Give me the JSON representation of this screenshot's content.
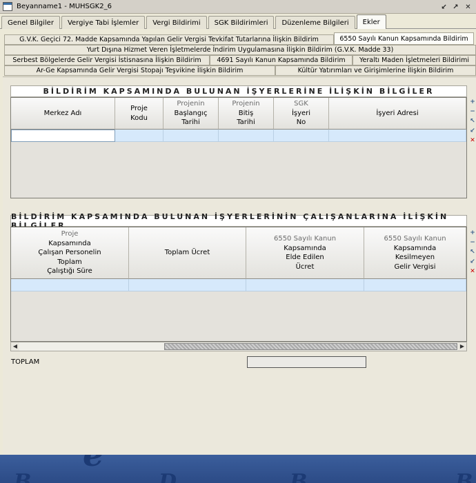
{
  "window": {
    "title": "Beyanname1 - MUHSGK2_6"
  },
  "main_tabs": [
    "Genel Bilgiler",
    "Vergiye Tabi İşlemler",
    "Vergi Bildirimi",
    "SGK Bildirimleri",
    "Düzenleme Bilgileri",
    "Ekler"
  ],
  "sub_tabs": {
    "row1": [
      "G.V.K. Geçici 72. Madde Kapsamında Yapılan Gelir Vergisi Tevkifat Tutarlarına İlişkin Bildirim",
      "6550 Sayılı Kanun Kapsamında Bildirim"
    ],
    "row2": [
      "Yurt Dışına Hizmet Veren İşletmelerde İndirim Uygulamasına İlişkin Bildirim (G.V.K. Madde 33)"
    ],
    "row3": [
      "Serbest Bölgelerde Gelir Vergisi İstisnasına İlişkin Bildirim",
      "4691 Sayılı Kanun Kapsamında Bildirim",
      "Yeraltı Maden İşletmeleri Bildirimi"
    ],
    "row4": [
      "Ar-Ge Kapsamında Gelir Vergisi Stopajı Teşvikine İlişkin Bildirim",
      "Kültür Yatırımları ve Girişimlerine İlişkin Bildirim"
    ]
  },
  "section1": {
    "title": "BİLDİRİM KAPSAMINDA BULUNAN İŞYERLERİNE İLİŞKİN BİLGİLER",
    "columns": [
      {
        "gray": "",
        "lines": [
          "Merkez Adı"
        ]
      },
      {
        "gray": "",
        "lines": [
          "Proje",
          "Kodu"
        ]
      },
      {
        "gray": "Projenin",
        "lines": [
          "Başlangıç",
          "Tarihi"
        ]
      },
      {
        "gray": "Projenin",
        "lines": [
          "Bitiş",
          "Tarihi"
        ]
      },
      {
        "gray": "SGK",
        "lines": [
          "İşyeri",
          "No"
        ]
      },
      {
        "gray": "",
        "lines": [
          "İşyeri Adresi"
        ]
      }
    ]
  },
  "section2": {
    "title": "BİLDİRİM KAPSAMINDA BULUNAN İŞYERLERİNİN ÇALIŞANLARINA İLİŞKİN BİLGİLER",
    "columns": [
      {
        "gray": "Proje",
        "lines": [
          "Kapsamında",
          "Çalışan Personelin",
          "Toplam",
          "Çalıştığı Süre"
        ]
      },
      {
        "gray": "",
        "lines": [
          "Toplam Ücret"
        ]
      },
      {
        "gray": "6550 Sayılı Kanun",
        "lines": [
          "Kapsamında",
          "Elde Edilen",
          "Ücret"
        ]
      },
      {
        "gray": "6550 Sayılı Kanun",
        "lines": [
          "Kapsamında",
          "Kesilmeyen",
          "Gelir Vergisi"
        ]
      }
    ]
  },
  "total": {
    "label": "TOPLAM",
    "value": ""
  },
  "side_buttons": [
    "add-row-icon",
    "remove-row-icon",
    "move-up-icon",
    "move-down-icon",
    "delete-icon"
  ],
  "colors": {
    "selected_row": "#d6e9fb",
    "panel_bg": "#ebe8dc",
    "bottom_band": "#2c4b86"
  }
}
